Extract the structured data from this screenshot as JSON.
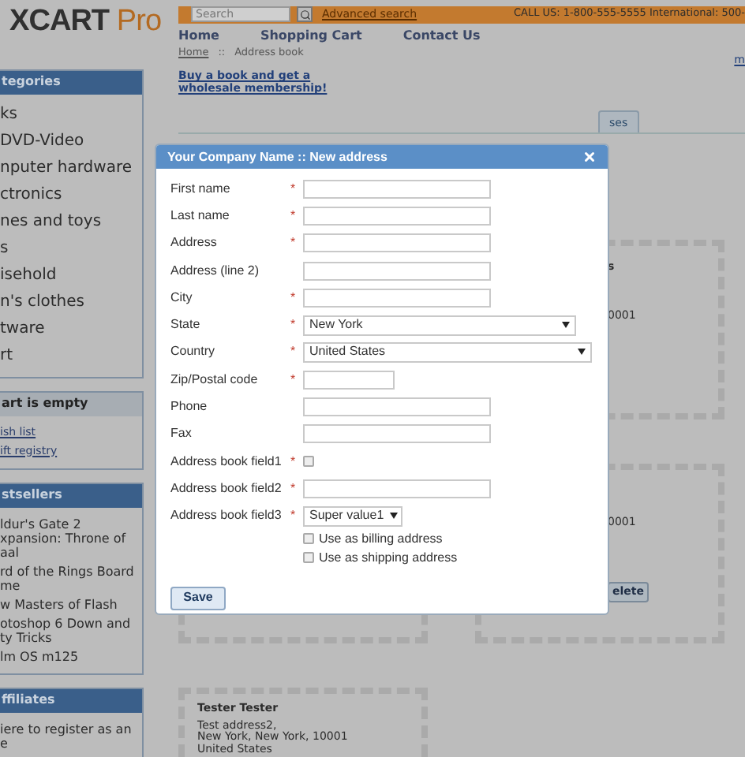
{
  "logo": {
    "brand": "XCART",
    "edition": "Pro"
  },
  "header": {
    "search_placeholder": "Search",
    "advanced_search": "Advanced search",
    "contact": "CALL US: 1-800-555-5555 International: 500-"
  },
  "nav": [
    "Home",
    "Shopping Cart",
    "Contact Us"
  ],
  "sidebar": [
    {
      "kind": "menu",
      "title": "tegories",
      "items": [
        "ks",
        "DVD-Video",
        "nputer hardware",
        "ctronics",
        "nes and toys",
        "s",
        "isehold",
        "n's clothes",
        "tware",
        "rt"
      ]
    },
    {
      "kind": "links",
      "title": "art is empty",
      "items": [
        "ish list",
        "ift registry"
      ]
    },
    {
      "kind": "menu",
      "title": "stsellers",
      "items": [
        "ldur's Gate 2 xpansion: Throne of aal",
        "rd of the Rings Board me",
        "w Masters of Flash",
        "otoshop 6 Down and ty Tricks",
        "lm OS m125"
      ]
    },
    {
      "kind": "menu",
      "title": "ffiliates",
      "items": [
        "iere to register as an e"
      ]
    }
  ],
  "breadcrumb": {
    "link": "Home",
    "separator": "::",
    "current": "Address book"
  },
  "promo": "Buy a book and get a wholesale membership!",
  "corner_link": "m",
  "tab": {
    "label": "ses",
    "selected": true
  },
  "cards": [
    {
      "lines": [
        "s",
        "0001"
      ]
    },
    {
      "lines": [
        "0001"
      ],
      "button": "elete"
    }
  ],
  "last_card": {
    "name": "Tester Tester",
    "lines": [
      "Test address2,",
      "New York, New York, 10001",
      "United States"
    ]
  },
  "dialog": {
    "title": "Your Company Name :: New address",
    "required_mark": "*",
    "fields": [
      {
        "kind": "text",
        "label": "First name",
        "required": true
      },
      {
        "kind": "text",
        "label": "Last name",
        "required": true
      },
      {
        "kind": "text",
        "label": "Address",
        "required": true
      },
      {
        "kind": "text",
        "label": "Address (line 2)",
        "required": false
      },
      {
        "kind": "text",
        "label": "City",
        "required": true
      },
      {
        "kind": "select",
        "label": "State",
        "required": true,
        "value": "New York"
      },
      {
        "kind": "select",
        "label": "Country",
        "required": true,
        "value": "United States"
      },
      {
        "kind": "text",
        "label": "Zip/Postal code",
        "required": true
      },
      {
        "kind": "text",
        "label": "Phone",
        "required": false
      },
      {
        "kind": "text",
        "label": "Fax",
        "required": false
      },
      {
        "kind": "checkbox",
        "label": "Address book field1",
        "required": true,
        "checked": false
      },
      {
        "kind": "text",
        "label": "Address book field2",
        "required": true
      },
      {
        "kind": "select",
        "label": "Address book field3",
        "required": true,
        "value": "Super value1"
      }
    ],
    "options": [
      {
        "label": "Use as billing address",
        "checked": false
      },
      {
        "label": "Use as shipping address",
        "checked": false
      }
    ],
    "save": "Save"
  }
}
